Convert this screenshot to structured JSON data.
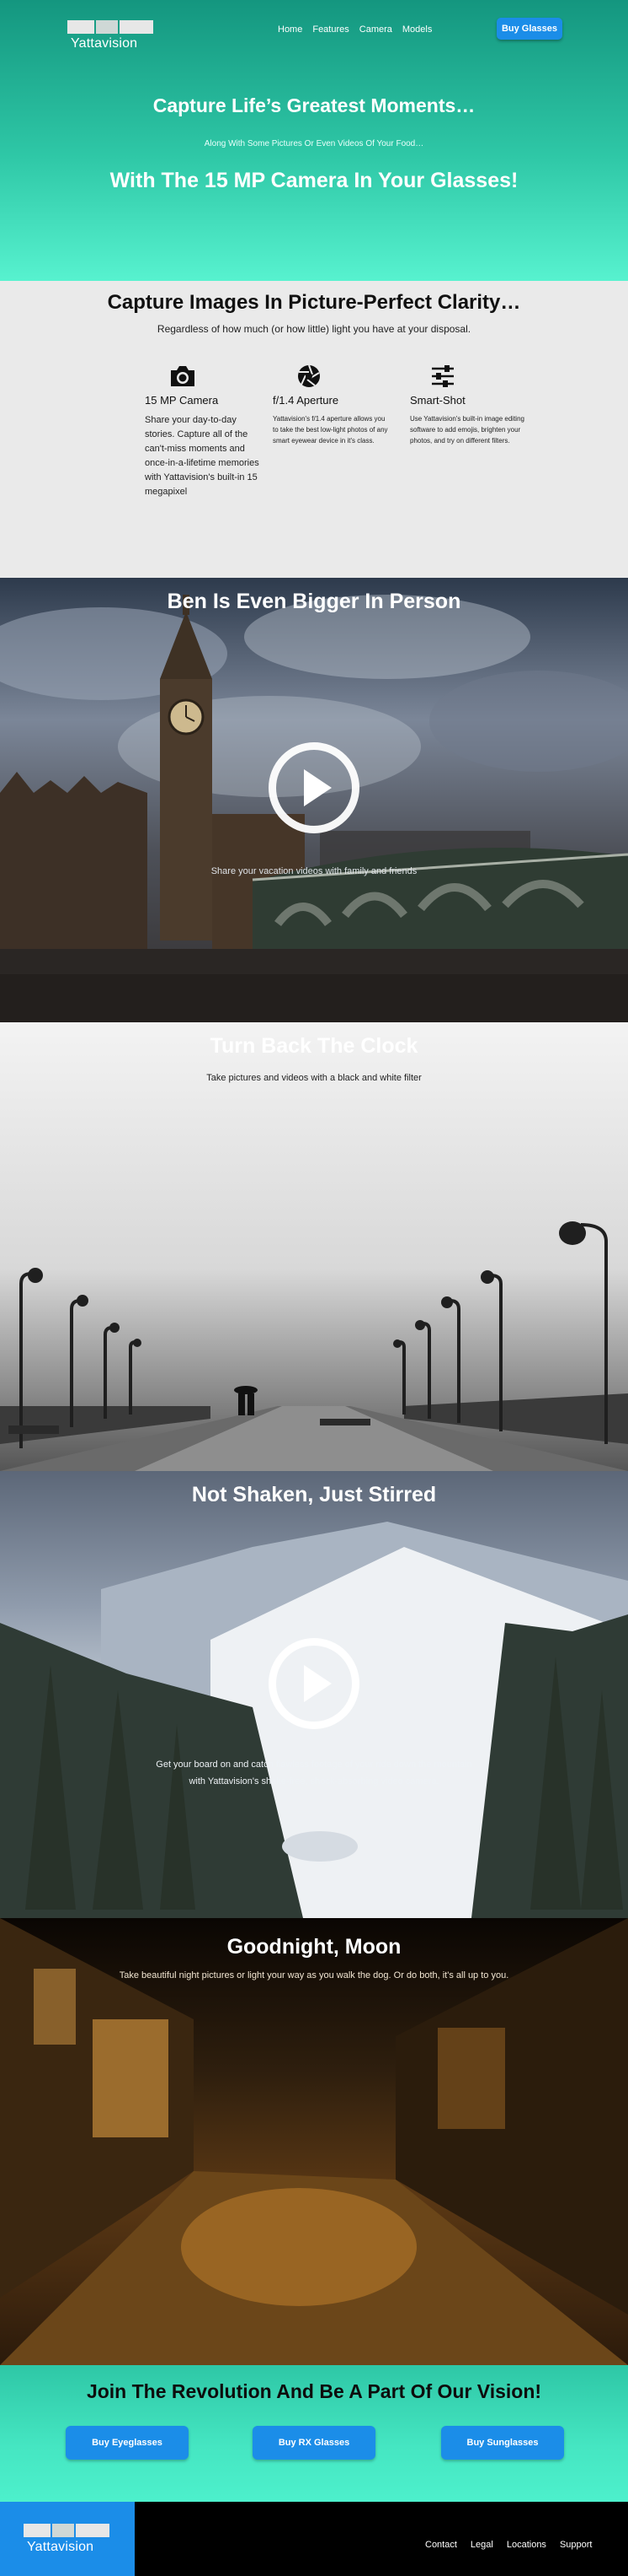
{
  "brand": {
    "name": "Yattavision"
  },
  "nav": {
    "links": [
      "Home",
      "Features",
      "Camera",
      "Models"
    ],
    "cta": "Buy Glasses"
  },
  "hero": {
    "headline": "Capture Life’s Greatest Moments…",
    "subline": "Along With Some Pictures Or Even Videos Of Your Food…",
    "headline2": "With The 15 MP Camera In Your Glasses!"
  },
  "features": {
    "title": "Capture Images In Picture-Perfect Clarity…",
    "subtitle": "Regardless of how much (or how little) light you have at your disposal.",
    "items": [
      {
        "icon": "camera-icon",
        "title": "15 MP Camera",
        "desc": "Share your day-to-day stories. Capture all of the can't-miss moments and once-in-a-lifetime memories with Yattavision's built-in 15 megapixel"
      },
      {
        "icon": "aperture-icon",
        "title": "f/1.4 Aperture",
        "desc": "Yattavision's f/1.4 aperture allows you to take the best low-light photos of any smart eyewear device in it's class."
      },
      {
        "icon": "sliders-icon",
        "title": "Smart-Shot",
        "desc": "Use Yattavision's built-in image editing software to add emojis, brighten your photos, and try on different filters."
      }
    ]
  },
  "sections": {
    "ben": {
      "title": "Ben Is Even Bigger In Person",
      "caption": "Share your vacation videos with family and friends"
    },
    "clock": {
      "title": "Turn Back The Clock",
      "caption": "Take pictures and videos with a black and white filter"
    },
    "shaken": {
      "title": "Not Shaken, Just Stirred",
      "caption1": "Get your board on and catch flawless footage of your ride down the mountain",
      "caption2": "with Yattavision's shake-free, shock-absorbing video camera."
    },
    "moon": {
      "title": "Goodnight, Moon",
      "caption": "Take beautiful night pictures or light your way as you walk the dog. Or do both, it's all up to you."
    }
  },
  "join": {
    "title": "Join The Revolution And Be A Part Of Our Vision!",
    "buttons": [
      "Buy Eyeglasses",
      "Buy RX Glasses",
      "Buy Sunglasses"
    ]
  },
  "footer": {
    "links": [
      "Contact",
      "Legal",
      "Locations",
      "Support"
    ]
  }
}
